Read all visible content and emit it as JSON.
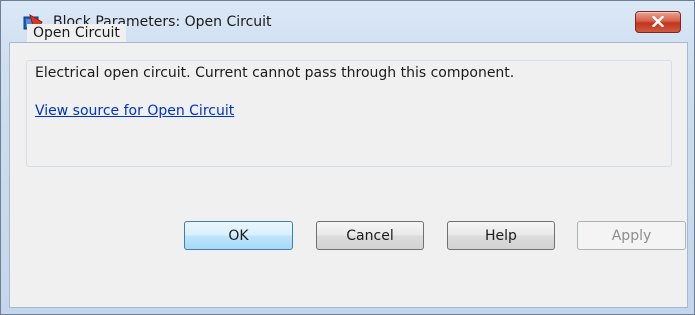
{
  "window": {
    "title": "Block Parameters: Open Circuit",
    "title_icon": "simulink-block-icon",
    "close_icon": "close-icon"
  },
  "group": {
    "legend": "Open Circuit",
    "description": "Electrical open circuit. Current cannot pass through this component.",
    "source_link": "View source for Open Circuit"
  },
  "buttons": {
    "ok": "OK",
    "cancel": "Cancel",
    "help": "Help",
    "apply": "Apply"
  },
  "colors": {
    "link": "#0033cc",
    "close_button": "#c2331d",
    "disabled_text": "#8d8d8d"
  }
}
